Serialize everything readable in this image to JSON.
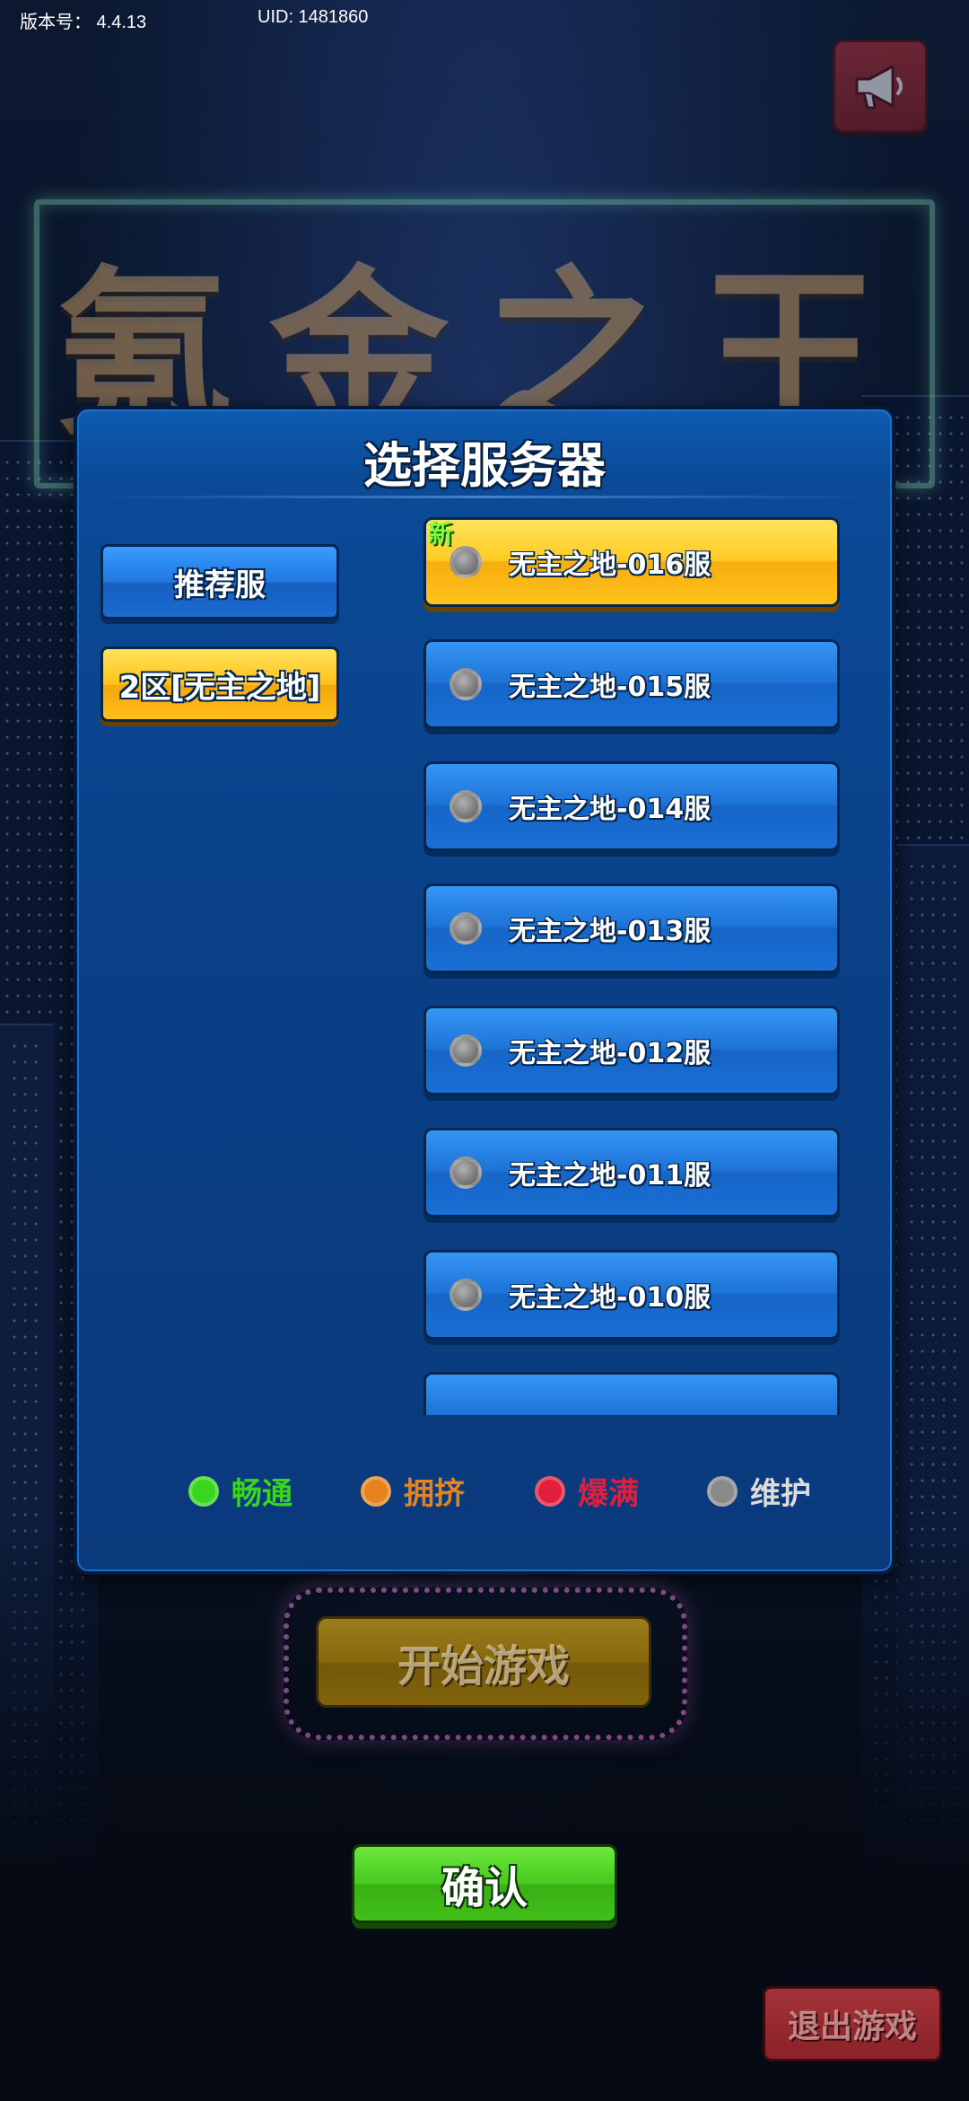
{
  "status": {
    "version_text": "版本号： 4.4.13",
    "uid_text": "UID: 1481860"
  },
  "announcement": {
    "icon": "megaphone-icon"
  },
  "background_title": "氪金之王",
  "dialog": {
    "title": "选择服务器",
    "tabs": [
      {
        "label": "推荐服",
        "state": "normal"
      },
      {
        "label": "2区[无主之地]",
        "state": "selected"
      }
    ],
    "servers": [
      {
        "label": "无主之地-016服",
        "badge": "新",
        "status": "maintenance",
        "state": "selected"
      },
      {
        "label": "无主之地-015服",
        "status": "maintenance",
        "state": "normal"
      },
      {
        "label": "无主之地-014服",
        "status": "maintenance",
        "state": "normal"
      },
      {
        "label": "无主之地-013服",
        "status": "maintenance",
        "state": "normal"
      },
      {
        "label": "无主之地-012服",
        "status": "maintenance",
        "state": "normal"
      },
      {
        "label": "无主之地-011服",
        "status": "maintenance",
        "state": "normal"
      },
      {
        "label": "无主之地-010服",
        "status": "maintenance",
        "state": "normal"
      }
    ],
    "legend": [
      {
        "label": "畅通",
        "color": "#3ad51e"
      },
      {
        "label": "拥挤",
        "color": "#e7831e"
      },
      {
        "label": "爆满",
        "color": "#e01f3d"
      },
      {
        "label": "维护",
        "color": "#8a8a8a"
      }
    ]
  },
  "buttons": {
    "start_game": "开始游戏",
    "confirm": "确认",
    "exit_game": "退出游戏"
  },
  "colors": {
    "dialog_blue": "#0a4a97",
    "tab_yellow": "#ffc21c",
    "confirm_green": "#46c920",
    "status_maintenance": "#8a8a8a"
  }
}
